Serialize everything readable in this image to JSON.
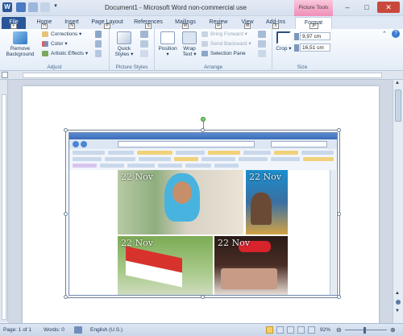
{
  "window": {
    "title": "Document1 - Microsoft Word non-commercial use",
    "contextual_tab": "Picture Tools"
  },
  "tabs": [
    {
      "label": "File",
      "keytip": "F"
    },
    {
      "label": "Home",
      "keytip": "H"
    },
    {
      "label": "Insert",
      "keytip": "N"
    },
    {
      "label": "Page Layout",
      "keytip": "P"
    },
    {
      "label": "References",
      "keytip": "S"
    },
    {
      "label": "Mailings",
      "keytip": "M"
    },
    {
      "label": "Review",
      "keytip": "R"
    },
    {
      "label": "View",
      "keytip": "W"
    },
    {
      "label": "Add-Ins",
      "keytip": "X"
    },
    {
      "label": "Format",
      "keytip": "JP"
    }
  ],
  "ribbon": {
    "adjust": {
      "label": "Adjust",
      "remove_background": "Remove Background",
      "corrections": "Corrections",
      "color": "Color",
      "artistic_effects": "Artistic Effects"
    },
    "picture_styles": {
      "label": "Picture Styles",
      "quick_styles": "Quick Styles"
    },
    "arrange": {
      "label": "Arrange",
      "position": "Position",
      "wrap_text": "Wrap Text",
      "bring_forward": "Bring Forward",
      "send_backward": "Send Backward",
      "selection_pane": "Selection Pane"
    },
    "size": {
      "label": "Size",
      "crop": "Crop",
      "height": "9,97 cm",
      "width": "16,51 cm"
    }
  },
  "picture": {
    "stamp_1": "22 Nov",
    "stamp_2": "22 Nov",
    "stamp_3": "22 Nov",
    "stamp_4": "22 Nov"
  },
  "status": {
    "page": "Page: 1 of 1",
    "words": "Words: 0",
    "language": "English (U.S.)",
    "zoom": "92%"
  },
  "colors": {
    "file_tab": "#2a5699",
    "contextual": "#f08eb8",
    "accent": "#1e395b"
  }
}
